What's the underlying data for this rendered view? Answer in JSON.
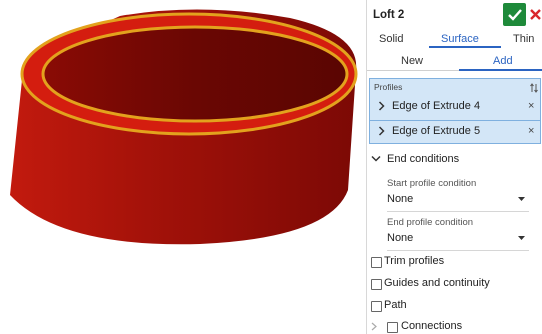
{
  "viewport": {
    "colors": {
      "surface_front": "#a31209",
      "surface_back": "#6d0703",
      "rim": "#e3a21d",
      "rim_fill": "#d41d0f"
    }
  },
  "panel": {
    "title": "Loft 2",
    "accept_icon": "check-icon",
    "cancel_icon": "close-icon",
    "type_tabs": [
      {
        "label": "Solid",
        "active": false
      },
      {
        "label": "Surface",
        "active": true
      },
      {
        "label": "Thin",
        "active": false
      }
    ],
    "op_tabs": [
      {
        "label": "New",
        "active": false
      },
      {
        "label": "Add",
        "active": true
      }
    ],
    "profiles": {
      "label": "Profiles",
      "items": [
        "Edge of Extrude 4",
        "Edge of Extrude 5"
      ],
      "remove_glyph": "×"
    },
    "end_conditions": {
      "label": "End conditions",
      "start_label": "Start profile condition",
      "start_value": "None",
      "end_label": "End profile condition",
      "end_value": "None"
    },
    "options": [
      {
        "label": "Trim profiles",
        "checked": false
      },
      {
        "label": "Guides and continuity",
        "checked": false
      },
      {
        "label": "Path",
        "checked": false
      },
      {
        "label": "Connections",
        "checked": false
      }
    ]
  }
}
